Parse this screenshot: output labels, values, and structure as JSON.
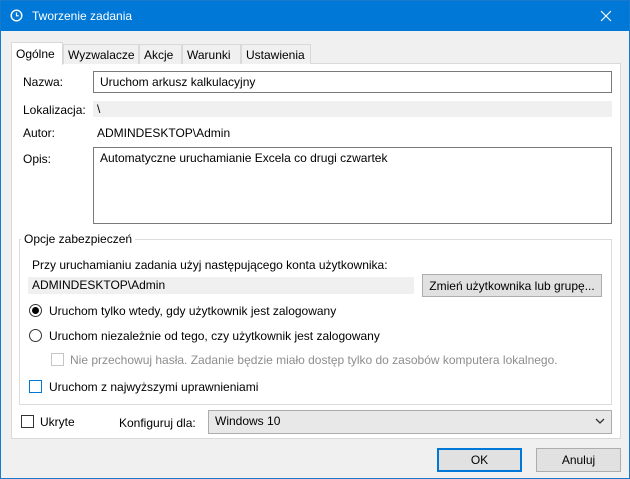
{
  "window": {
    "title": "Tworzenie zadania",
    "icon": "task-scheduler-icon",
    "close_icon": "close-icon"
  },
  "tabs": [
    {
      "label": "Ogólne",
      "active": true
    },
    {
      "label": "Wyzwalacze"
    },
    {
      "label": "Akcje"
    },
    {
      "label": "Warunki"
    },
    {
      "label": "Ustawienia"
    }
  ],
  "general": {
    "name_label": "Nazwa:",
    "name_value": "Uruchom arkusz kalkulacyjny",
    "location_label": "Lokalizacja:",
    "location_value": "\\",
    "author_label": "Autor:",
    "author_value": "ADMINDESKTOP\\Admin",
    "description_label": "Opis:",
    "description_value": "Automatyczne uruchamianie Excela co drugi czwartek"
  },
  "security": {
    "legend": "Opcje zabezpieczeń",
    "account_prompt": "Przy uruchamianiu zadania użyj następującego konta użytkownika:",
    "account_value": "ADMINDESKTOP\\Admin",
    "change_user_button": "Zmień użytkownika lub grupę...",
    "radio_logged_on": "Uruchom tylko wtedy, gdy użytkownik jest zalogowany",
    "radio_logged_on_selected": true,
    "radio_whether_logged": "Uruchom niezależnie od tego, czy użytkownik jest zalogowany",
    "no_store_password": "Nie przechowuj hasła. Zadanie będzie miało dostęp tylko do zasobów komputera lokalnego.",
    "highest_privileges": "Uruchom z najwyższymi uprawnieniami"
  },
  "footer": {
    "hidden_label": "Ukryte",
    "configure_label": "Konfiguruj dla:",
    "configure_value": "Windows 10",
    "ok_button": "OK",
    "cancel_button": "Anuluj"
  }
}
